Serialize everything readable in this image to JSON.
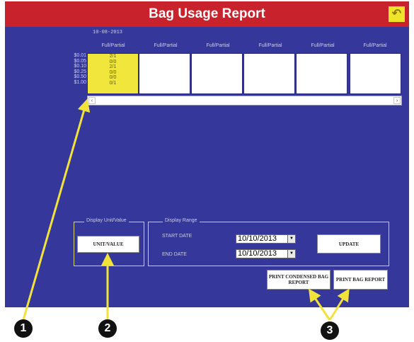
{
  "header": {
    "title": "Bag Usage Report",
    "back_icon": "back-arrow-icon",
    "colors": {
      "title_bar": "#c8232c",
      "back_button": "#f0e42a"
    }
  },
  "grid": {
    "date": "10-08-2013",
    "column_header": "Full/Partial",
    "columns": [
      "Full/Partial",
      "Full/Partial",
      "Full/Partial",
      "Full/Partial",
      "Full/Partial",
      "Full/Partial"
    ],
    "denominations": [
      "$0.01",
      "$0.05",
      "$0.10",
      "$0.25",
      "$0.50",
      "$1.00"
    ],
    "first_column_values": [
      "2/1",
      "0/0",
      "2/1",
      "0/0",
      "0/0",
      "0/1"
    ]
  },
  "display_unit": {
    "group_title": "Display Unit/Value",
    "button_label": "UNIT/VALUE"
  },
  "display_range": {
    "group_title": "Display Range",
    "start_label": "START DATE",
    "start_value": "10/10/2013",
    "end_label": "END DATE",
    "end_value": "10/10/2013",
    "update_label": "UPDATE"
  },
  "print": {
    "condensed_label": "PRINT CONDENSED BAG REPORT",
    "full_label": "PRINT BAG REPORT"
  },
  "callouts": [
    "1",
    "2",
    "3"
  ],
  "colors": {
    "panel": "#36379a",
    "highlight": "#f0e63c",
    "arrow": "#f2e33a"
  }
}
